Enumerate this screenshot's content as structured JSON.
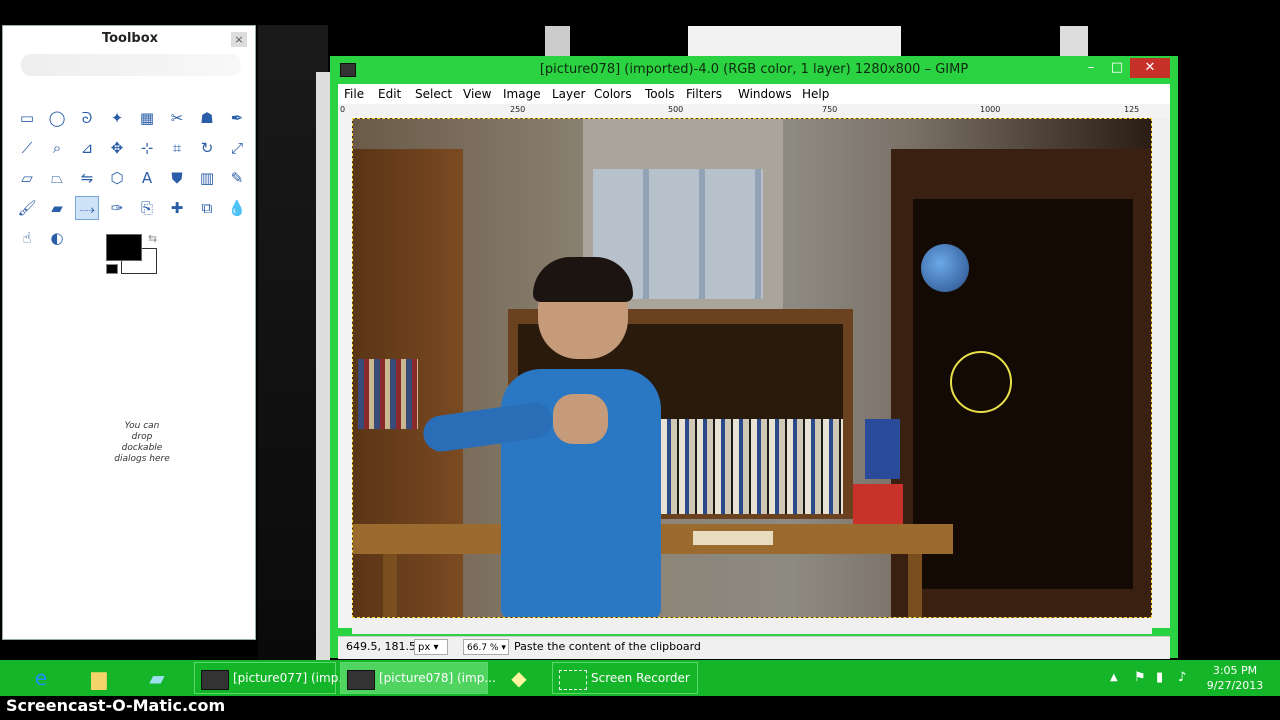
{
  "toolbox": {
    "title": "Toolbox",
    "close_glyph": "×",
    "dock_hint": "You can drop dockable dialogs here",
    "colors": {
      "foreground": "#000000",
      "background": "#ffffff"
    },
    "tools": [
      "rect-select-icon",
      "ellipse-select-icon",
      "free-select-icon",
      "fuzzy-select-icon",
      "color-select-icon",
      "scissors-select-icon",
      "foreground-select-icon",
      "paths-icon",
      "color-picker-icon",
      "zoom-icon",
      "measure-icon",
      "move-icon",
      "align-icon",
      "crop-icon",
      "rotate-icon",
      "scale-icon",
      "shear-icon",
      "perspective-icon",
      "flip-icon",
      "cage-icon",
      "text-icon",
      "bucket-fill-icon",
      "blend-icon",
      "pencil-icon",
      "paintbrush-icon",
      "eraser-icon",
      "airbrush-icon",
      "ink-icon",
      "clone-icon",
      "heal-icon",
      "perspective-clone-icon",
      "blur-icon",
      "smudge-icon",
      "dodge-icon"
    ]
  },
  "gimp": {
    "title": "[picture078] (imported)-4.0 (RGB color, 1 layer) 1280x800 – GIMP",
    "min_glyph": "–",
    "max_glyph": "□",
    "close_glyph": "✕",
    "menu": [
      "File",
      "Edit",
      "Select",
      "View",
      "Image",
      "Layer",
      "Colors",
      "Tools",
      "Filters",
      "Windows",
      "Help"
    ],
    "ruler_top": [
      "0",
      "250",
      "500",
      "750",
      "1000",
      "125"
    ],
    "ruler_left": [
      "0",
      "2\n5\n0",
      "5\n0\n0"
    ],
    "status": {
      "coords": "649.5, 181.5",
      "unit": "px",
      "zoom": "66.7 %",
      "message": "Paste the content of the clipboard"
    }
  },
  "taskbar": {
    "buttons": [
      {
        "label": "[picture077] (imp..."
      },
      {
        "label": "[picture078] (imp..."
      },
      {
        "label": "Screen Recorder"
      }
    ],
    "clock_time": "3:05 PM",
    "clock_date": "9/27/2013",
    "tray_up": "▲"
  },
  "watermark": "Screencast-O-Matic.com"
}
